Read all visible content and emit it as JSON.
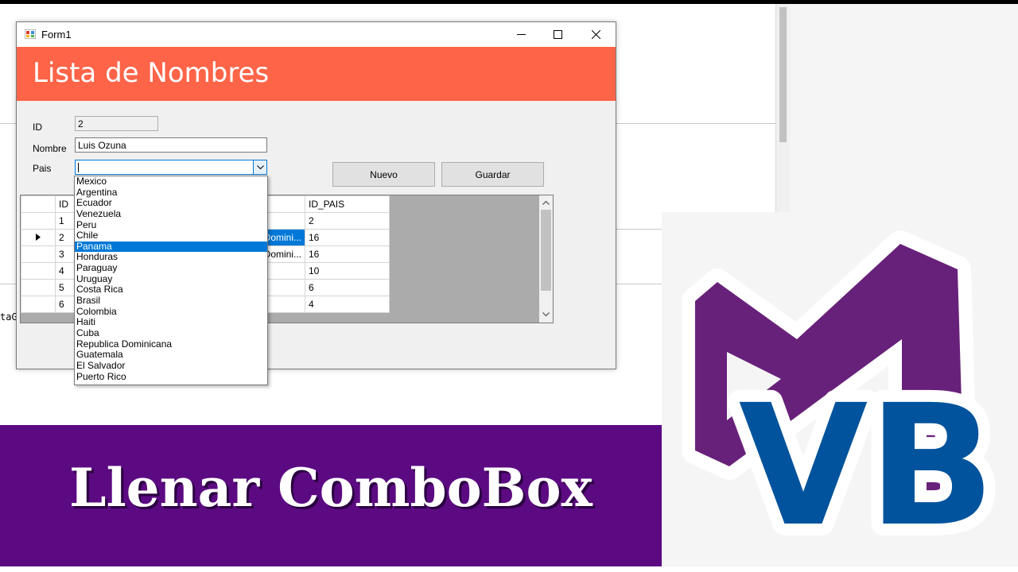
{
  "form": {
    "title": "Form1",
    "banner_title": "Lista de Nombres",
    "labels": {
      "id": "ID",
      "nombre": "Nombre",
      "pais": "Pais"
    },
    "id_value": "2",
    "nombre_value": "Luis Ozuna",
    "pais_value": "",
    "buttons": {
      "nuevo": "Nuevo",
      "guardar": "Guardar"
    }
  },
  "grid": {
    "headers": [
      "ID",
      "",
      "ID_PAIS"
    ],
    "rows": [
      {
        "id": "1",
        "pais_text": "",
        "id_pais": "2"
      },
      {
        "id": "2",
        "pais_text": "Domini...",
        "id_pais": "16"
      },
      {
        "id": "3",
        "pais_text": "Domini...",
        "id_pais": "16"
      },
      {
        "id": "4",
        "pais_text": "",
        "id_pais": "10"
      },
      {
        "id": "5",
        "pais_text": "",
        "id_pais": "6"
      },
      {
        "id": "6",
        "pais_text": "",
        "id_pais": "4"
      }
    ]
  },
  "dropdown": {
    "items": [
      "Mexico",
      "Argentina",
      "Ecuador",
      "Venezuela",
      "Peru",
      "Chile",
      "Panama",
      "Honduras",
      "Paraguay",
      "Uruguay",
      "Costa Rica",
      "Brasil",
      "Colombia",
      "Haiti",
      "Cuba",
      "Republica Dominicana",
      "Guatemala",
      "El Salvador",
      "Puerto Rico"
    ],
    "highlighted": "Panama"
  },
  "background": {
    "code_fragment": "taG"
  },
  "caption": "Llenar ComboBox",
  "logo": {
    "text": "VB"
  },
  "colors": {
    "banner": "#fe6448",
    "caption_bg": "#5c0a82",
    "logo_purple": "#68217a",
    "logo_blue": "#00539c"
  }
}
